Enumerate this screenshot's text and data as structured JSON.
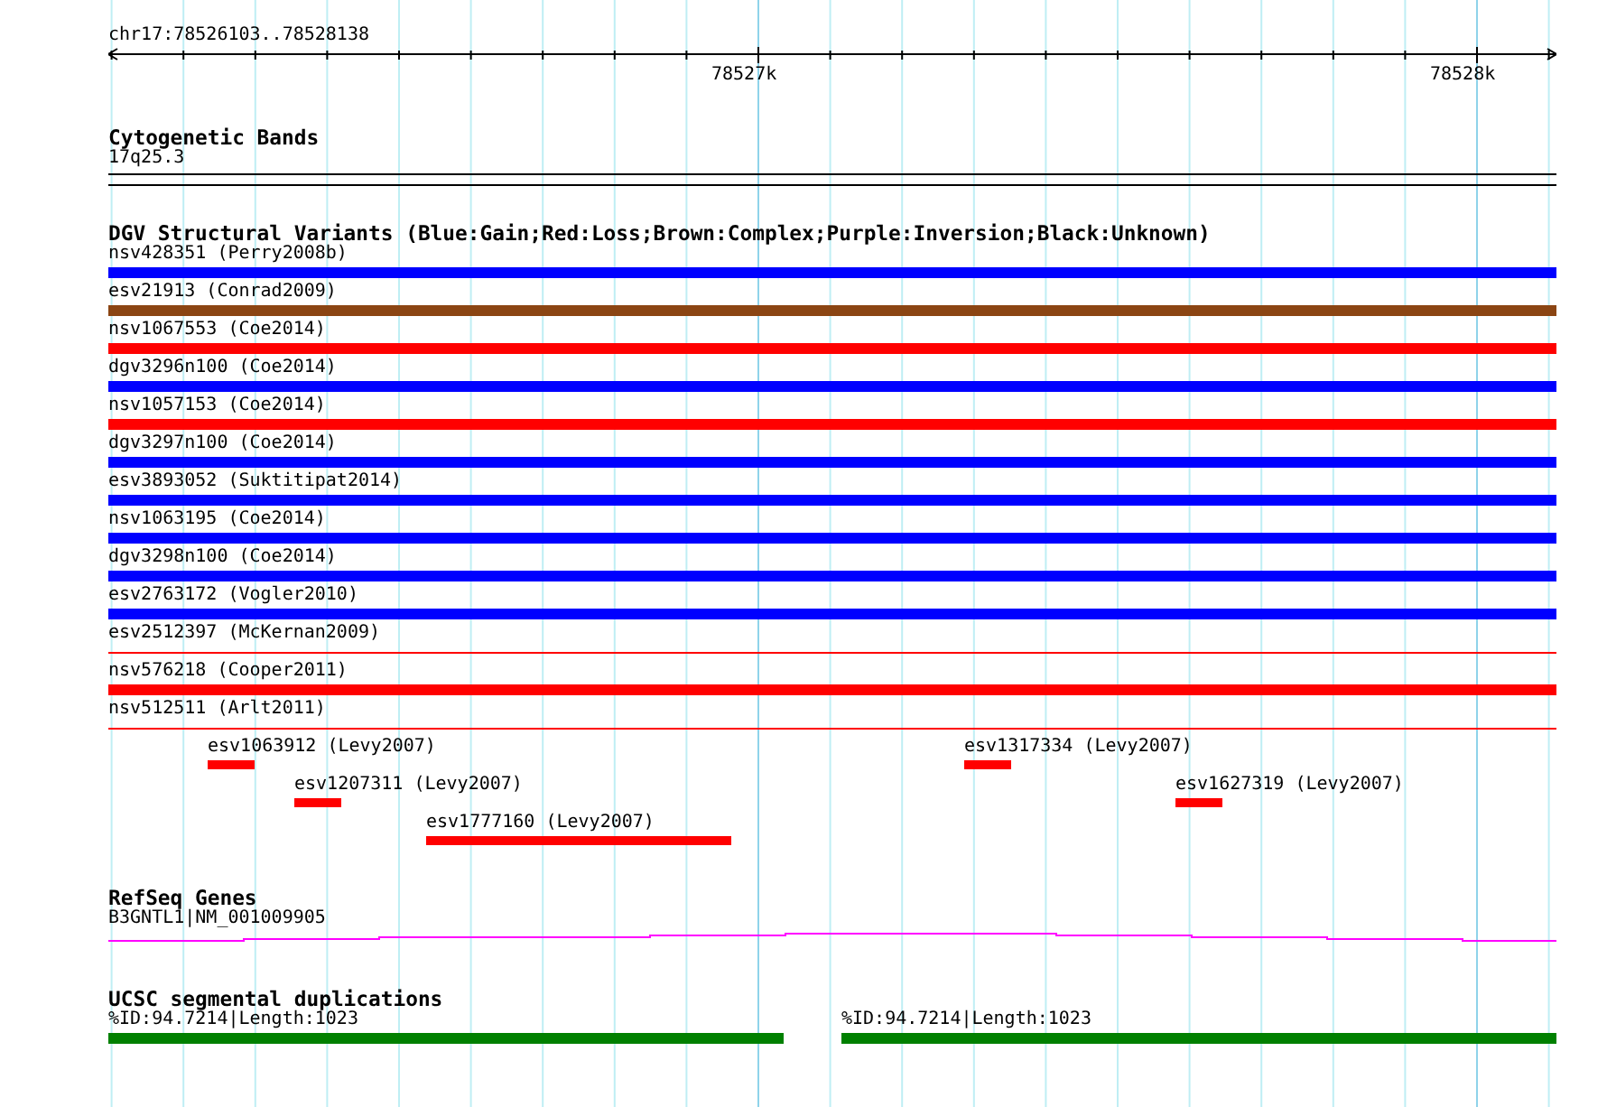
{
  "ruler": {
    "range": "chr17:78526103..78528138",
    "ticks": [
      "78527k",
      "78528k"
    ]
  },
  "tracks": [
    {
      "kind": "bands",
      "title": "Cytogenetic Bands",
      "label": "17q25.3"
    },
    {
      "kind": "variants",
      "title": "DGV Structural Variants (Blue:Gain;Red:Loss;Brown:Complex;Purple:Inversion;Black:Unknown)",
      "rows": [
        {
          "label": "nsv428351 (Perry2008b)",
          "color": "#0000ff",
          "kind": "bar"
        },
        {
          "label": "esv21913 (Conrad2009)",
          "color": "#8b4513",
          "kind": "bar"
        },
        {
          "label": "nsv1067553 (Coe2014)",
          "color": "#ff0000",
          "kind": "bar"
        },
        {
          "label": "dgv3296n100 (Coe2014)",
          "color": "#0000ff",
          "kind": "bar"
        },
        {
          "label": "nsv1057153 (Coe2014)",
          "color": "#ff0000",
          "kind": "bar"
        },
        {
          "label": "dgv3297n100 (Coe2014)",
          "color": "#0000ff",
          "kind": "bar"
        },
        {
          "label": "esv3893052 (Suktitipat2014)",
          "color": "#0000ff",
          "kind": "bar"
        },
        {
          "label": "nsv1063195 (Coe2014)",
          "color": "#0000ff",
          "kind": "bar"
        },
        {
          "label": "dgv3298n100 (Coe2014)",
          "color": "#0000ff",
          "kind": "bar"
        },
        {
          "label": "esv2763172 (Vogler2010)",
          "color": "#0000ff",
          "kind": "bar"
        },
        {
          "label": "esv2512397 (McKernan2009)",
          "color": "#ff0000",
          "kind": "line"
        },
        {
          "label": "nsv576218 (Cooper2011)",
          "color": "#ff0000",
          "kind": "bar"
        },
        {
          "label": "nsv512511 (Arlt2011)",
          "color": "#ff0000",
          "kind": "line"
        }
      ],
      "features": [
        {
          "label": "esv1063912 (Levy2007)",
          "color": "#ff0000"
        },
        {
          "label": "esv1207311 (Levy2007)",
          "color": "#ff0000"
        },
        {
          "label": "esv1777160 (Levy2007)",
          "color": "#ff0000"
        },
        {
          "label": "esv1317334 (Levy2007)",
          "color": "#ff0000"
        },
        {
          "label": "esv1627319 (Levy2007)",
          "color": "#ff0000"
        }
      ]
    },
    {
      "kind": "genes",
      "title": "RefSeq Genes",
      "label": "B3GNTL1|NM_001009905"
    },
    {
      "kind": "segdups",
      "title": "UCSC segmental duplications",
      "features": [
        {
          "label": "%ID:94.7214|Length:1023"
        },
        {
          "label": "%ID:94.7214|Length:1023"
        }
      ]
    }
  ]
}
